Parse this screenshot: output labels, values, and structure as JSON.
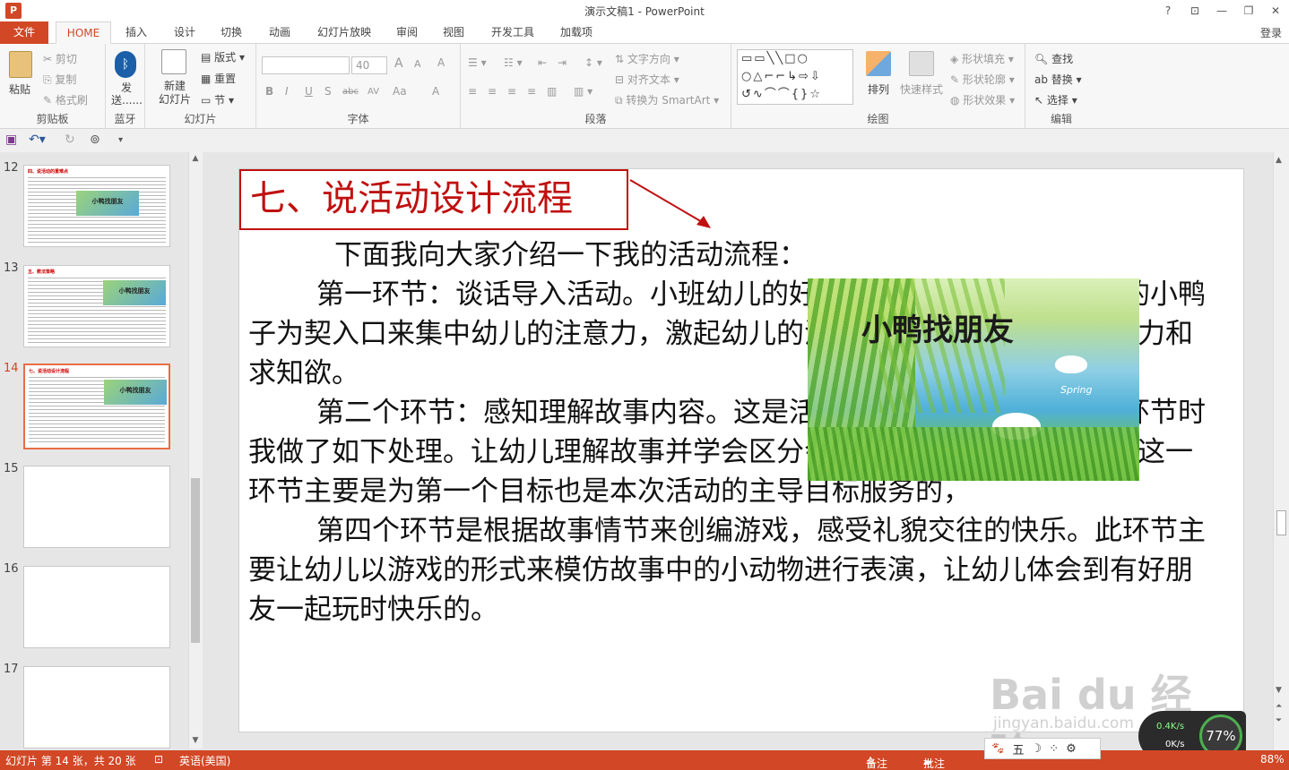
{
  "window": {
    "app_icon": "P",
    "title": "演示文稿1 - PowerPoint",
    "help": "?",
    "minimize": "—",
    "restore": "❐",
    "close": "✕",
    "ribbon_display": "⊡",
    "login": "登录"
  },
  "tabs": {
    "file": "文件",
    "items": [
      "HOME",
      "插入",
      "设计",
      "切换",
      "动画",
      "幻灯片放映",
      "审阅",
      "视图",
      "开发工具",
      "加载项"
    ]
  },
  "ribbon": {
    "clipboard": {
      "label": "剪贴板",
      "paste": "粘贴",
      "cut": "剪切",
      "copy": "复制",
      "format_painter": "格式刷"
    },
    "bluetooth": {
      "label": "蓝牙",
      "send": "发送......"
    },
    "slides": {
      "label": "幻灯片",
      "new_slide": "新建\n幻灯片",
      "layout": "版式",
      "reset": "重置",
      "section": "节"
    },
    "font": {
      "label": "字体",
      "font_name": "",
      "font_size": "40",
      "grow": "A",
      "shrink": "A",
      "clear": "A",
      "bold": "B",
      "italic": "I",
      "underline": "U",
      "shadow": "S",
      "strike": "abc",
      "spacing": "AV",
      "case": "Aa",
      "color": "A"
    },
    "paragraph": {
      "label": "段落",
      "text_direction": "文字方向",
      "align_text": "对齐文本",
      "smartart": "转换为 SmartArt"
    },
    "drawing": {
      "label": "绘图",
      "arrange": "排列",
      "quick_styles": "快速样式",
      "shape_fill": "形状填充",
      "shape_outline": "形状轮廓",
      "shape_effects": "形状效果"
    },
    "editing": {
      "label": "编辑",
      "find": "查找",
      "replace": "替换",
      "select": "选择"
    }
  },
  "thumbnails": [
    {
      "num": "12",
      "title": "四、说活动的重难点",
      "pic": "小鸭找朋友",
      "active": false,
      "blank": false
    },
    {
      "num": "13",
      "title": "五、教法策略",
      "pic": "小鸭找朋友",
      "active": false,
      "blank": false
    },
    {
      "num": "14",
      "title": "七、说活动设计流程",
      "pic": "小鸭找朋友",
      "active": true,
      "blank": false
    },
    {
      "num": "15",
      "title": "",
      "pic": "",
      "active": false,
      "blank": true
    },
    {
      "num": "16",
      "title": "",
      "pic": "",
      "active": false,
      "blank": true
    },
    {
      "num": "17",
      "title": "",
      "pic": "",
      "active": false,
      "blank": true
    }
  ],
  "slide": {
    "title": "七、说活动设计流程",
    "paragraphs": [
      "下面我向大家介绍一下我的活动流程：",
      "第一环节：谈话导入活动。小班幼儿的好奇心强，我从一只正在哭的小鸭子为契入口来集中幼儿的注意力，激起幼儿的活动兴趣，发展幼儿的想象力和求知欲。",
      "第二个环节：感知理解故事内容。这是活动的重点部分，在进行此环节时我做了如下处理。让幼儿理解故事并学会区分会游泳和不会游泳的动物。这一环节主要是为第一个目标也是本次活动的主导目标服务的，",
      "第四个环节是根据故事情节来创编游戏，感受礼貌交往的快乐。此环节主要让幼儿以游戏的形式来模仿故事中的小动物进行表演，让幼儿体会到有好朋友一起玩时快乐的。"
    ],
    "picture_title": "小鸭找朋友",
    "picture_brand": "Spring"
  },
  "status": {
    "slide_info": "幻灯片 第 14 张，共 20 张",
    "language": "英语(美国)",
    "notes": "备注",
    "comments": "批注",
    "zoom": "88%"
  },
  "overlay": {
    "watermark_logo": "Bai du 经验",
    "watermark_url": "jingyan.baidu.com",
    "paw_toolbar": [
      "五",
      "☽",
      "⁘",
      "⚙"
    ],
    "speed_up": "0.4K/s",
    "speed_down": "0K/s",
    "percent": "77%"
  },
  "colors": {
    "accent": "#d24726",
    "title_red": "#c01010"
  }
}
